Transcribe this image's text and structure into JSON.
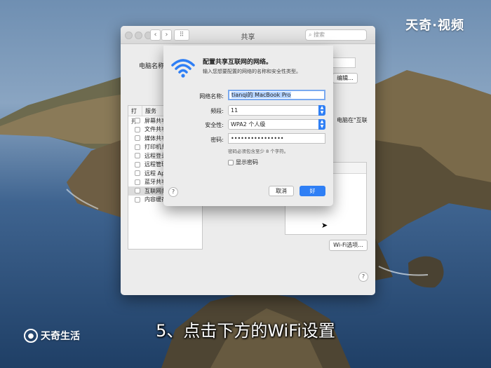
{
  "watermark": {
    "top": "天奇·视频",
    "bottom": "天奇生活",
    "logo_icon": "search-circle-icon"
  },
  "caption": "5、点击下方的WiFi设置",
  "window": {
    "title": "共享",
    "search_placeholder": "搜索",
    "back_icon": "‹",
    "forward_icon": "›",
    "grid_icon": "⠿",
    "computer_name_label": "电脑名称:",
    "edit_button": "编辑...",
    "services_header": {
      "on": "打开",
      "service": "服务"
    },
    "services": [
      {
        "label": "屏幕共享",
        "checked": false
      },
      {
        "label": "文件共享",
        "checked": false
      },
      {
        "label": "媒体共享",
        "checked": false
      },
      {
        "label": "打印机共享",
        "checked": false
      },
      {
        "label": "远程登录",
        "checked": false
      },
      {
        "label": "远程管理",
        "checked": false
      },
      {
        "label": "远程 Apple 事件",
        "checked": false
      },
      {
        "label": "蓝牙共享",
        "checked": false
      },
      {
        "label": "互联网共享",
        "checked": false,
        "selected": true
      },
      {
        "label": "内容缓存",
        "checked": false
      }
    ],
    "side_note": "电脑在\"互联",
    "wifi_options_button": "Wi-Fi选项...",
    "help": "?"
  },
  "sheet": {
    "title": "配置共享互联网的网络。",
    "subtitle": "输入您想要配置的网络的名称和安全性类型。",
    "network_name_label": "网络名称:",
    "network_name_value": "tianqi的 MacBook Pro",
    "channel_label": "频段:",
    "channel_value": "11",
    "security_label": "安全性:",
    "security_value": "WPA2 个人级",
    "password_label": "密码:",
    "password_value": "••••••••••••••••",
    "password_hint": "密码必须包含至少 8 个字符。",
    "show_password_label": "显示密码",
    "cancel_button": "取消",
    "ok_button": "好",
    "help": "?",
    "accent_color": "#2f7ff5"
  }
}
